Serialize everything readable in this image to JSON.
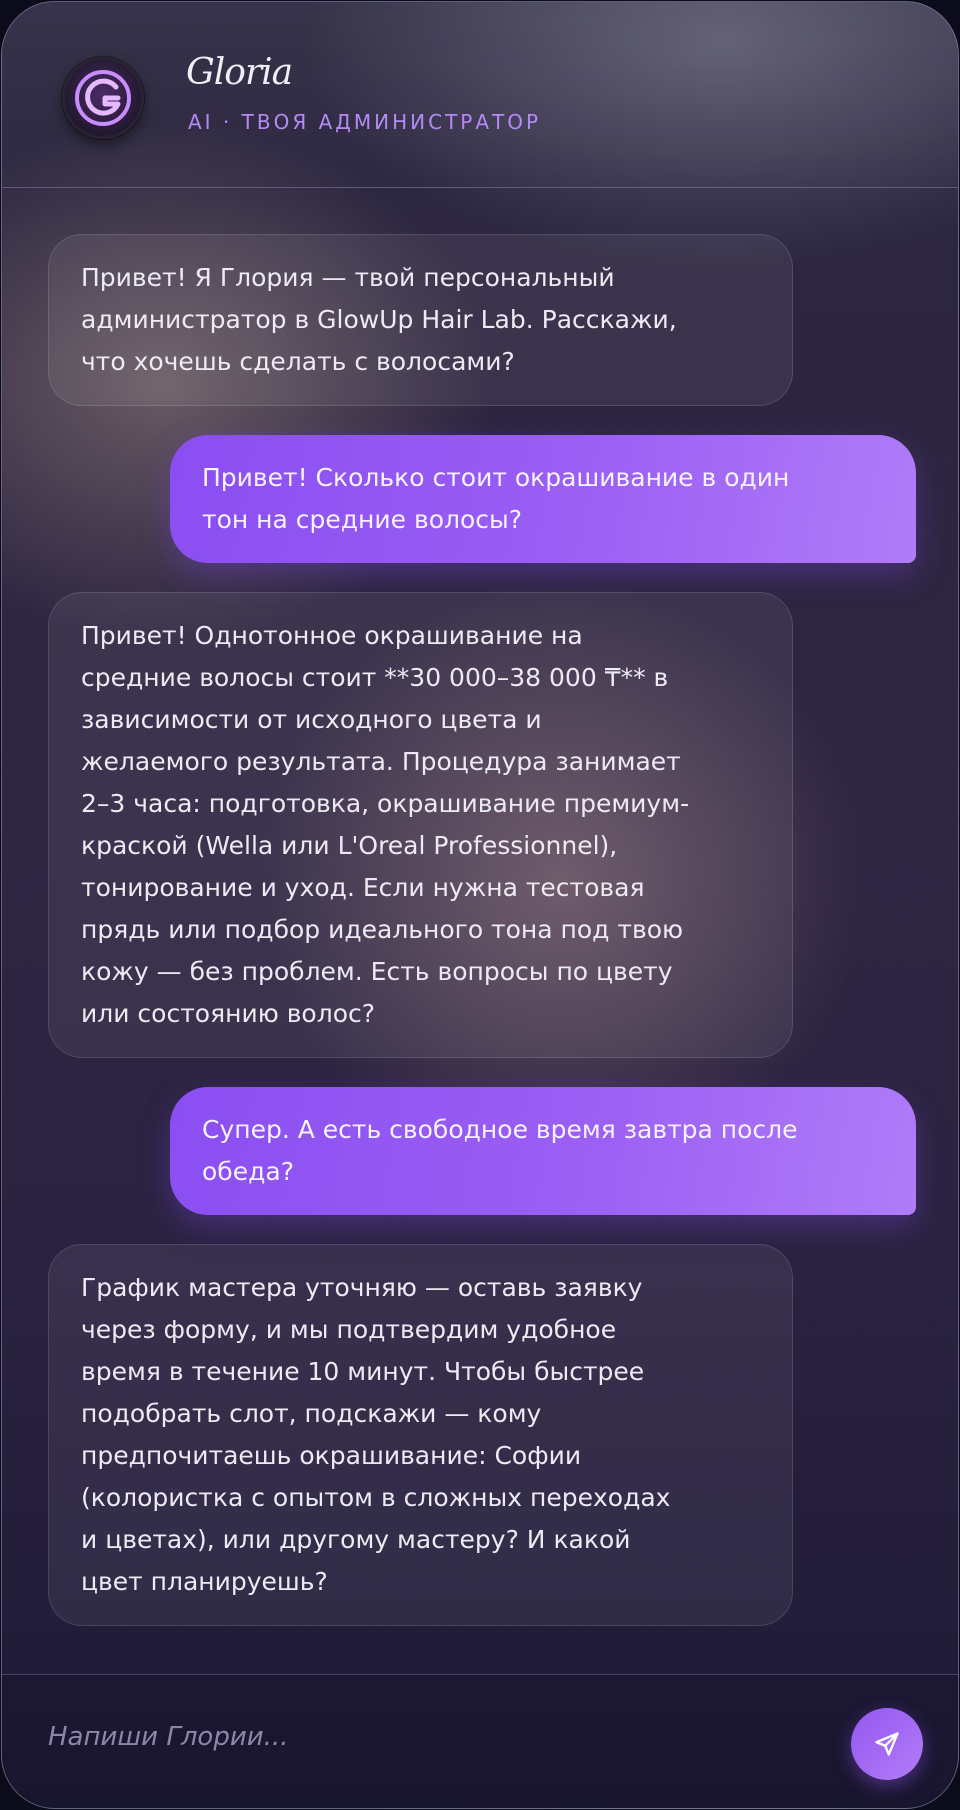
{
  "header": {
    "name": "Gloria",
    "subtitle": "AI · ТВОЯ АДМИНИСТРАТОР",
    "avatar_icon": "g-logo-icon"
  },
  "messages": [
    {
      "role": "bot",
      "text": "Привет! Я Глория — твой персональный\nадминистратор в GlowUp Hair Lab. Расскажи,\nчто хочешь сделать с волосами?"
    },
    {
      "role": "user",
      "text": "Привет! Сколько стоит окрашивание в один\nтон на средние волосы?"
    },
    {
      "role": "bot",
      "text": "Привет! Однотонное окрашивание на\nсредние волосы стоит **30 000–38 000 ₸** в\nзависимости от исходного цвета и\nжелаемого результата. Процедура занимает\n2–3 часа: подготовка, окрашивание премиум-\nкраской (Wella или L'Oreal Professionnel),\nтонирование и уход. Если нужна тестовая\nпрядь или подбор идеального тона под твою\nкожу — без проблем. Есть вопросы по цвету\nили состоянию волос?"
    },
    {
      "role": "user",
      "text": "Супер. А есть свободное время завтра после\nобеда?"
    },
    {
      "role": "bot",
      "text": "График мастера уточняю — оставь заявку\nчерез форму, и мы подтвердим удобное\nвремя в течение 10 минут. Чтобы быстрее\nподобрать слот, подскажи — кому\nпредпочитаешь окрашивание: Софии\n(колористка с опытом в сложных переходах\nи цветах), или другому мастеру? И какой\nцвет планируешь?"
    }
  ],
  "composer": {
    "placeholder": "Напиши Глории...",
    "value": "",
    "send_icon": "send-icon"
  },
  "colors": {
    "accent": "#9b5ff4",
    "accent_light": "#b07cf8",
    "subtitle": "#b58af6"
  }
}
